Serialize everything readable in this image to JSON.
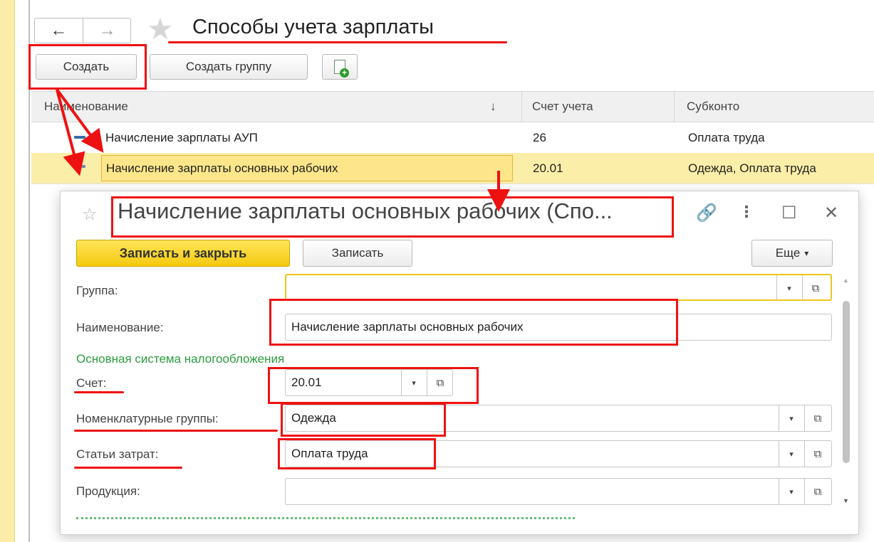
{
  "nav": {
    "back_icon": "←",
    "forward_icon": "→",
    "favorite_icon": "★"
  },
  "list": {
    "title": "Способы учета зарплаты",
    "toolbar": {
      "create_label": "Создать",
      "create_group_label": "Создать группу",
      "add_copy_icon": "add-document-icon"
    },
    "columns": {
      "name": "Наименование",
      "sort_indicator": "↓",
      "account": "Счет учета",
      "subconto": "Субконто"
    },
    "rows": [
      {
        "name": "Начисление зарплаты АУП",
        "account": "26",
        "subconto": "Оплата труда"
      },
      {
        "name": "Начисление зарплаты основных рабочих",
        "account": "20.01",
        "subconto": "Одежда, Оплата труда"
      }
    ]
  },
  "form": {
    "title": "Начисление зарплаты основных рабочих (Спо...",
    "controls": {
      "star": "☆",
      "link": "🔗",
      "more": "⋮",
      "maximize": "☐",
      "close": "✕"
    },
    "buttons": {
      "save_close": "Записать и закрыть",
      "save": "Записать",
      "more": "Еще",
      "more_arrow": "▾"
    },
    "fields": {
      "group": {
        "label": "Группа:",
        "value": ""
      },
      "name": {
        "label": "Наименование:",
        "value": "Начисление зарплаты основных рабочих"
      },
      "section": "Основная система налогообложения",
      "account": {
        "label": "Счет:",
        "value": "20.01"
      },
      "nomenclature_groups": {
        "label": "Номенклатурные группы:",
        "value": "Одежда"
      },
      "cost_items": {
        "label": "Статьи затрат:",
        "value": "Оплата труда"
      },
      "products": {
        "label": "Продукция:",
        "value": ""
      }
    },
    "dropdown_glyph": "▾",
    "open_glyph": "⧉"
  },
  "colors": {
    "accent_yellow": "#f4c90e",
    "selection": "#fbeea8",
    "annotation": "#ee1111",
    "section_green": "#2a9d3e"
  }
}
